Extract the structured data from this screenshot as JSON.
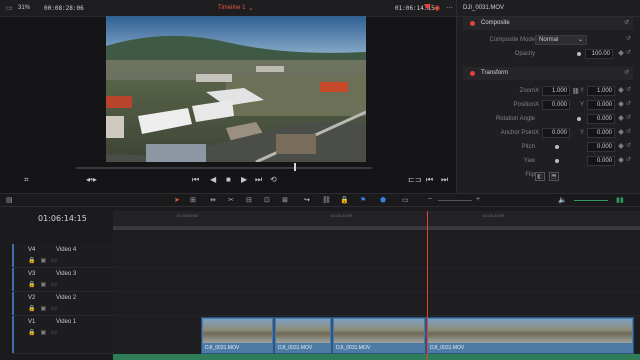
{
  "viewer": {
    "zoom": "31%",
    "timecode_left": "00:08:28:06",
    "timeline_name": "Timeline 1",
    "timecode_right": "01:06:14:15"
  },
  "inspector": {
    "clip_name": "DJI_0031.MOV",
    "composite": {
      "title": "Composite",
      "mode_label": "Composite Mode",
      "mode_value": "Normal",
      "opacity_label": "Opacity",
      "opacity_value": "100.00"
    },
    "transform": {
      "title": "Transform",
      "zoom_label": "Zoom",
      "zoom_x": "1.000",
      "zoom_y": "1.000",
      "position_label": "Position",
      "position_x": "0.000",
      "position_y": "0.000",
      "rotation_label": "Rotation Angle",
      "rotation_value": "0.000",
      "anchor_label": "Anchor Point",
      "anchor_x": "0.000",
      "anchor_y": "0.000",
      "pitch_label": "Pitch",
      "pitch_value": "0.000",
      "yaw_label": "Yaw",
      "yaw_value": "0.000",
      "flip_label": "Flip",
      "axis_x": "X",
      "axis_y": "Y"
    }
  },
  "timeline": {
    "current_tc": "01:06:14:15",
    "ruler_ticks": [
      "01:06:00:00",
      "01:06:10:00",
      "01:06:20:00"
    ],
    "tracks": [
      {
        "id": "V4",
        "name": "Video 4"
      },
      {
        "id": "V3",
        "name": "Video 3"
      },
      {
        "id": "V2",
        "name": "Video 2"
      },
      {
        "id": "V1",
        "name": "Video 1"
      }
    ],
    "clips": [
      {
        "name": "DJI_0031.MOV"
      },
      {
        "name": "DJI_0031.MOV"
      },
      {
        "name": "DJI_0031.MOV"
      },
      {
        "name": "DJI_0031.MOV"
      }
    ]
  },
  "colors": {
    "accent_red": "#e2423a",
    "clip_blue": "#4e7aa6",
    "audio_green": "#2f7c58"
  }
}
